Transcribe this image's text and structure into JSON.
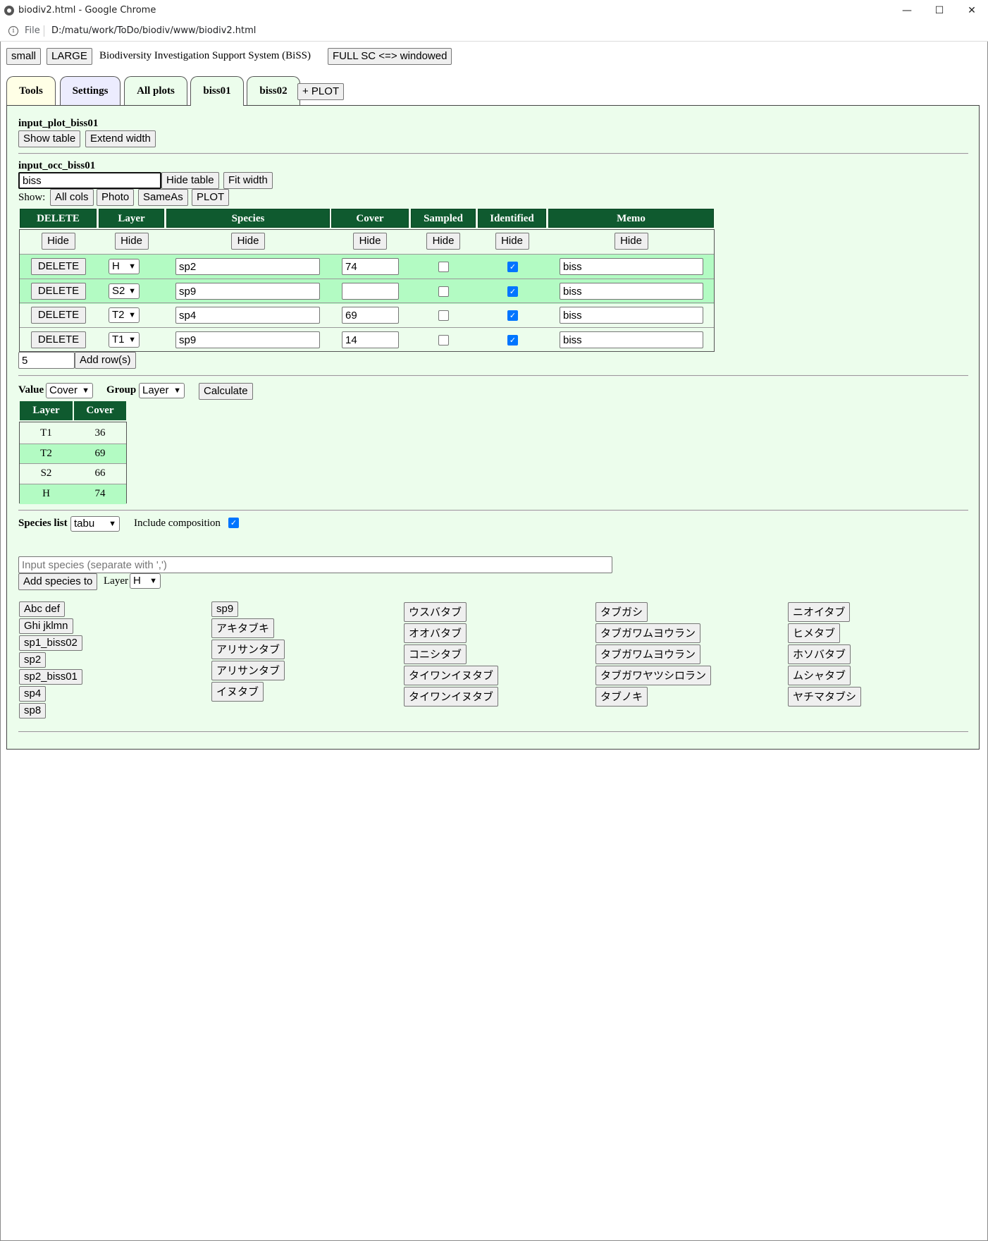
{
  "window": {
    "title": "biodiv2.html - Google Chrome",
    "controls": {
      "minimize": "—",
      "maximize": "☐",
      "close": "✕"
    }
  },
  "addressbar": {
    "scheme_label": "File",
    "url": "D:/matu/work/ToDo/biodiv/www/biodiv2.html"
  },
  "header": {
    "small_label": "small",
    "large_label": "LARGE",
    "app_title": "Biodiversity Investigation Support System (BiSS)",
    "fullscreen_label": "FULL SC <=> windowed"
  },
  "tabs": [
    {
      "label": "Tools",
      "bg": "#ffffe6"
    },
    {
      "label": "Settings",
      "bg": "#ececfe"
    },
    {
      "label": "All plots",
      "bg": "#ecfdec"
    },
    {
      "label": "biss01",
      "bg": "#ecfdec",
      "active": true
    },
    {
      "label": "biss02",
      "bg": "#ecfdec"
    }
  ],
  "add_plot_label": "+ PLOT",
  "plot_section": {
    "heading": "input_plot_biss01",
    "show_table_label": "Show table",
    "extend_width_label": "Extend width"
  },
  "occ_section": {
    "heading": "input_occ_biss01",
    "input_value": "biss",
    "hide_table_label": "Hide table",
    "fit_width_label": "Fit width",
    "show_label": "Show:",
    "show_buttons": [
      "All cols",
      "Photo",
      "SameAs",
      "PLOT"
    ],
    "columns": [
      "DELETE",
      "Layer",
      "Species",
      "Cover",
      "Sampled",
      "Identified",
      "Memo"
    ],
    "hide_label": "Hide",
    "delete_label": "DELETE",
    "rows": [
      {
        "layer": "H",
        "species": "sp2",
        "cover": "74",
        "sampled": false,
        "identified": true,
        "memo": "biss"
      },
      {
        "layer": "S2",
        "species": "sp9",
        "cover": "",
        "sampled": false,
        "identified": true,
        "memo": "biss"
      },
      {
        "layer": "T2",
        "species": "sp4",
        "cover": "69",
        "sampled": false,
        "identified": true,
        "memo": "biss"
      },
      {
        "layer": "T1",
        "species": "sp9",
        "cover": "14",
        "sampled": false,
        "identified": true,
        "memo": "biss"
      }
    ],
    "add_rows_value": "5",
    "add_rows_label": "Add row(s)"
  },
  "calc_section": {
    "value_label": "Value",
    "value_selected": "Cover",
    "group_label": "Group",
    "group_selected": "Layer",
    "calculate_label": "Calculate",
    "columns": [
      "Layer",
      "Cover"
    ],
    "rows": [
      {
        "layer": "T1",
        "cover": "36"
      },
      {
        "layer": "T2",
        "cover": "69"
      },
      {
        "layer": "S2",
        "cover": "66"
      },
      {
        "layer": "H",
        "cover": "74"
      }
    ]
  },
  "species_section": {
    "list_label": "Species list",
    "list_selected": "tabu",
    "include_label": "Include composition",
    "include_checked": true,
    "input_placeholder": "Input species (separate with ',')",
    "add_label": "Add species to",
    "layer_label": "Layer",
    "layer_selected": "H",
    "columns": [
      [
        "Abc def",
        "Ghi jklmn",
        "sp1_biss02",
        "sp2",
        "sp2_biss01",
        "sp4",
        "sp8"
      ],
      [
        "sp9",
        "アキタブキ",
        "アリサンタブ",
        "アリサンタブ",
        "イヌタブ"
      ],
      [
        "ウスバタブ",
        "オオバタブ",
        "コニシタブ",
        "タイワンイヌタブ",
        "タイワンイヌタブ"
      ],
      [
        "タブガシ",
        "タブガワムヨウラン",
        "タブガワムヨウラン",
        "タブガワヤツシロラン",
        "タブノキ"
      ],
      [
        "ニオイタブ",
        "ヒメタブ",
        "ホソバタブ",
        "ムシャタブ",
        "ヤチマタブシ"
      ]
    ]
  },
  "colors": {
    "panel_bg": "#ecfdec",
    "header_green": "#0f5a2f",
    "row_highlight": "#b3fbc3",
    "check_blue": "#0075ff"
  }
}
